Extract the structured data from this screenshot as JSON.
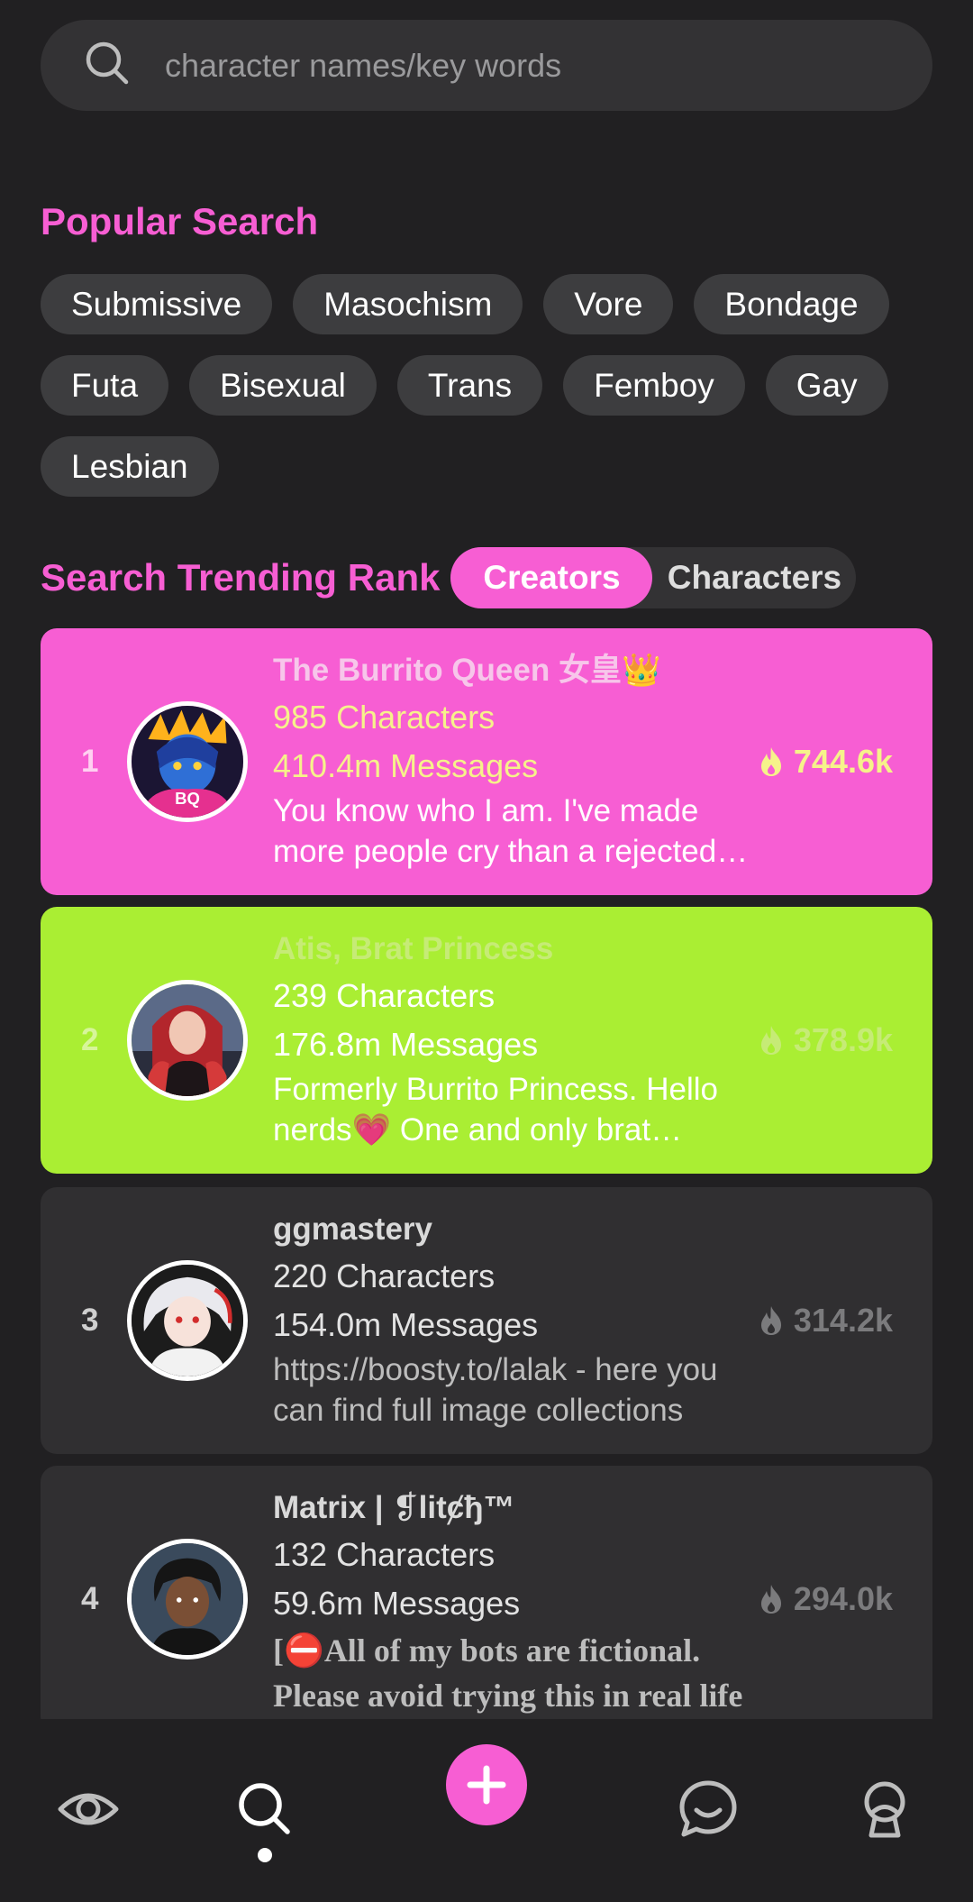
{
  "search": {
    "placeholder": "character names/key words",
    "value": ""
  },
  "popular": {
    "title": "Popular Search",
    "tags": [
      "Submissive",
      "Masochism",
      "Vore",
      "Bondage",
      "Futa",
      "Bisexual",
      "Trans",
      "Femboy",
      "Gay",
      "Lesbian"
    ]
  },
  "trending": {
    "title": "Search Trending Rank",
    "tabs": [
      {
        "label": "Creators",
        "active": true
      },
      {
        "label": "Characters",
        "active": false
      }
    ],
    "items": [
      {
        "rank": "1",
        "name": "The Burrito Queen 女皇👑",
        "characters": "985 Characters",
        "messages": "410.4m Messages",
        "bio": "You know who I am. I've made more people cry than a rejected proposal",
        "heat": "744.6k",
        "card_color": "#f75ed3"
      },
      {
        "rank": "2",
        "name": "Atis, Brat Princess",
        "characters": "239 Characters",
        "messages": "176.8m Messages",
        "bio": "Formerly Burrito Princess. Hello nerds💗 One and only brat princess here",
        "heat": "378.9k",
        "card_color": "#aaee33"
      },
      {
        "rank": "3",
        "name": "ggmastery",
        "characters": "220 Characters",
        "messages": "154.0m Messages",
        "bio": "https://boosty.to/lalak - here you can find full image collections",
        "heat": "314.2k",
        "card_color": "#302f31"
      },
      {
        "rank": "4",
        "name": "Matrix | ❡litȼђ™",
        "characters": "132 Characters",
        "messages": "59.6m Messages",
        "bio": "[⛔All of my bots are fictional. Please avoid trying this in real life",
        "heat": "294.0k",
        "card_color": "#302f31"
      }
    ]
  },
  "nav": {
    "items": [
      "eye-icon",
      "search-icon",
      "add-icon",
      "chat-icon",
      "profile-icon"
    ],
    "active": "search-icon",
    "accent": "#f75ed3"
  }
}
